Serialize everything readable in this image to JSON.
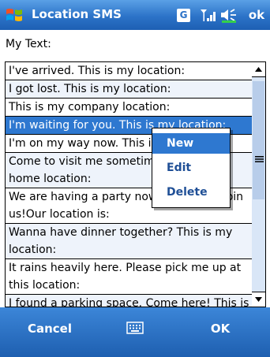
{
  "app": {
    "title": "Location SMS"
  },
  "status": {
    "g_indicator": "G",
    "ok_label": "ok",
    "icons": [
      "windows-logo",
      "signal-icon",
      "volume-icon"
    ]
  },
  "label": "My Text:",
  "list": {
    "items": [
      "I've arrived. This is my location:",
      "I got lost. This is my location:",
      "This is my company location:",
      "I'm waiting for you. This is my location:",
      "I'm on my way now. This is my location:",
      "Come to visit me sometime! This is my home location:",
      "We are having a party now. Come and join us!Our location is:",
      "Wanna have dinner together? This is my location:",
      "It rains heavily here. Please pick me up at this location:",
      "I found a parking space. Come here! This is my location:"
    ],
    "selected_index": 3
  },
  "context_menu": {
    "items": [
      "New",
      "Edit",
      "Delete"
    ],
    "highlighted_index": 0
  },
  "softkeys": {
    "left": "Cancel",
    "right": "OK"
  },
  "colors": {
    "titlebar": "#2c73c8",
    "selection": "#2e78d0",
    "menu_text": "#1f4f96"
  }
}
